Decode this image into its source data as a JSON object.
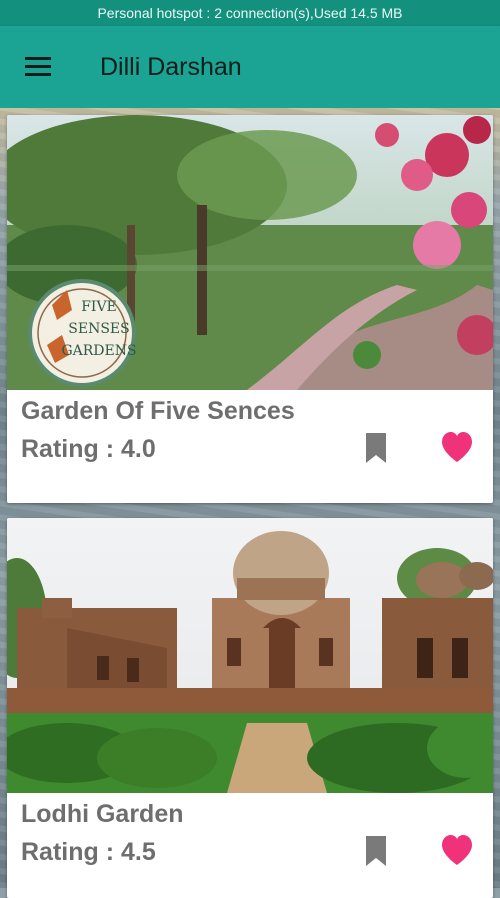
{
  "status_bar": {
    "text": "Personal hotspot : 2 connection(s),Used  14.5 MB"
  },
  "app_bar": {
    "title": "Dilli Darshan",
    "menu_icon": "hamburger-menu-icon"
  },
  "places": [
    {
      "name": "Garden Of Five Sences",
      "rating": "Rating : 4.0",
      "logo_text": "FIVE SENSES GARDENS",
      "bookmark_icon": "bookmark-icon",
      "favorite_icon": "heart-icon"
    },
    {
      "name": "Lodhi Garden",
      "rating": "Rating : 4.5",
      "bookmark_icon": "bookmark-icon",
      "favorite_icon": "heart-icon"
    }
  ],
  "colors": {
    "status_bar": "#14907f",
    "app_bar": "#1ba393",
    "heart": "#f0327a",
    "bookmark": "#7a7a7a",
    "card_text": "#6e6e6e"
  }
}
